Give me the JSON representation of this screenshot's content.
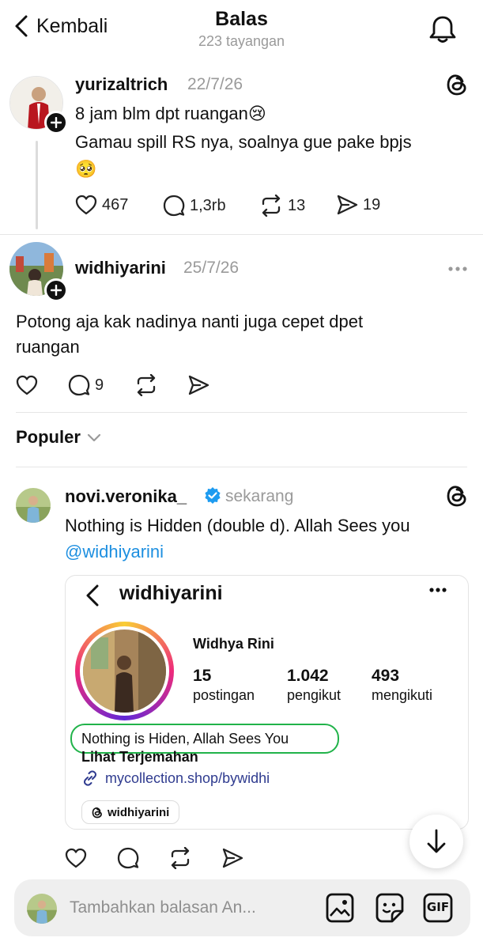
{
  "header": {
    "back_label": "Kembali",
    "title": "Balas",
    "views": "223 tayangan"
  },
  "post1": {
    "username": "yurizaltrich",
    "time": "22/7/26",
    "line1": "8 jam blm dpt ruangan😢",
    "line2": "Gamau spill RS nya, soalnya gue pake bpjs",
    "line3": "🥺",
    "likes": "467",
    "replies": "1,3rb",
    "reposts": "13",
    "shares": "19"
  },
  "post2": {
    "username": "widhiyarini",
    "time": "25/7/26",
    "line1": "Potong aja kak nadinya nanti juga cepet dpet",
    "line2": "ruangan",
    "replies": "9"
  },
  "sort": {
    "label": "Populer"
  },
  "post3": {
    "username": "novi.veronika_",
    "time": "sekarang",
    "text": "Nothing is Hidden (double d). Allah Sees you",
    "mention": "@widhiyarini",
    "embed": {
      "username": "widhiyarini",
      "name": "Widhya Rini",
      "posts_count": "15",
      "posts_label": "postingan",
      "followers_count": "1.042",
      "followers_label": "pengikut",
      "following_count": "493",
      "following_label": "mengikuti",
      "bio": "Nothing is Hiden, Allah Sees You",
      "translate": "Lihat Terjemahan",
      "link": "mycollection.shop/bywidhi",
      "threads_chip": "widhiyarini"
    }
  },
  "compose": {
    "placeholder": "Tambahkan balasan An...",
    "gif_label": "GIF"
  },
  "colors": {
    "verified": "#1d9bf0",
    "mention": "#1d8fe0",
    "annotation_circle": "#21b34a"
  }
}
